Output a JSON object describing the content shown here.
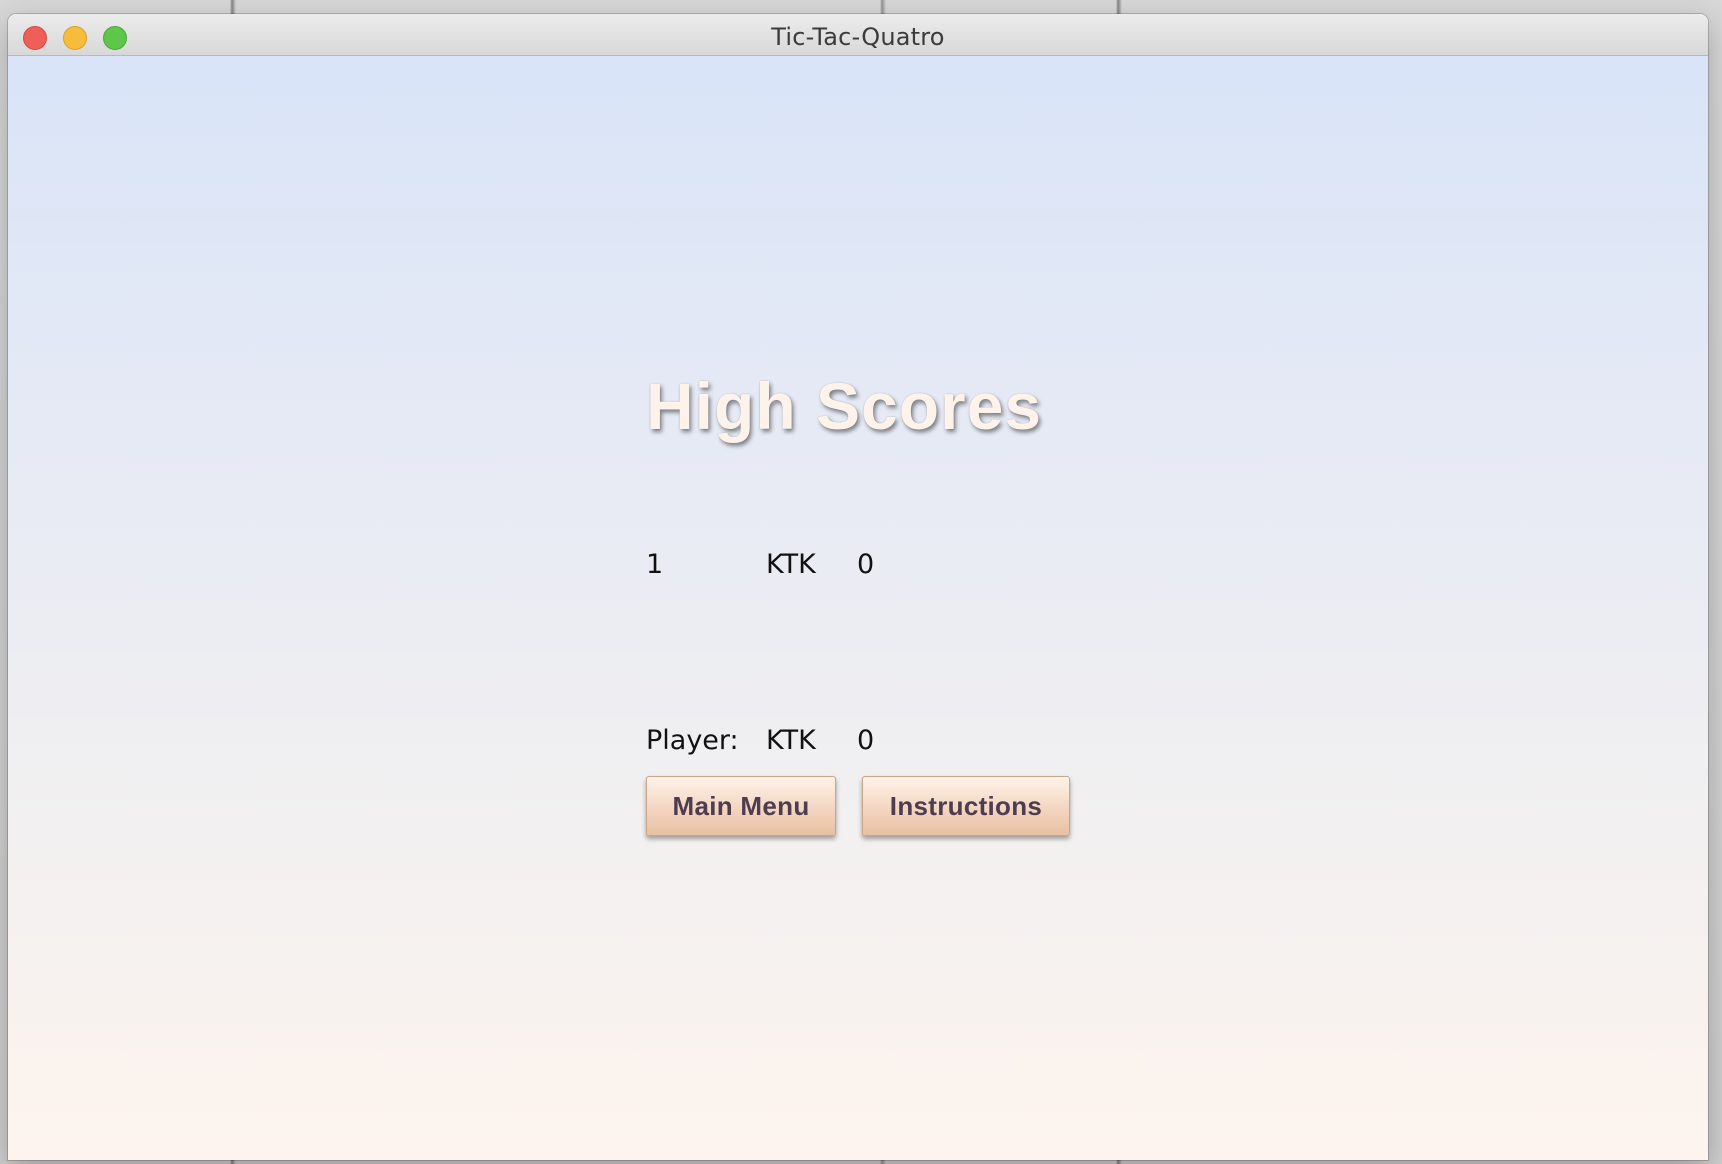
{
  "window": {
    "title": "Tic-Tac-Quatro"
  },
  "high_scores": {
    "heading": "High Scores",
    "entries": [
      {
        "rank": "1",
        "name": "KTK",
        "score": "0"
      }
    ]
  },
  "player": {
    "label": "Player:",
    "name": "KTK",
    "score": "0"
  },
  "buttons": {
    "main_menu": "Main Menu",
    "instructions": "Instructions"
  },
  "colors": {
    "heading": "#fdf3ea",
    "button_text": "#4e3d50",
    "button_fill_top": "#fff3ea",
    "button_fill_bottom": "#e8c0a2",
    "background_top": "#d9e4f8",
    "background_bottom": "#fdf4ee"
  }
}
